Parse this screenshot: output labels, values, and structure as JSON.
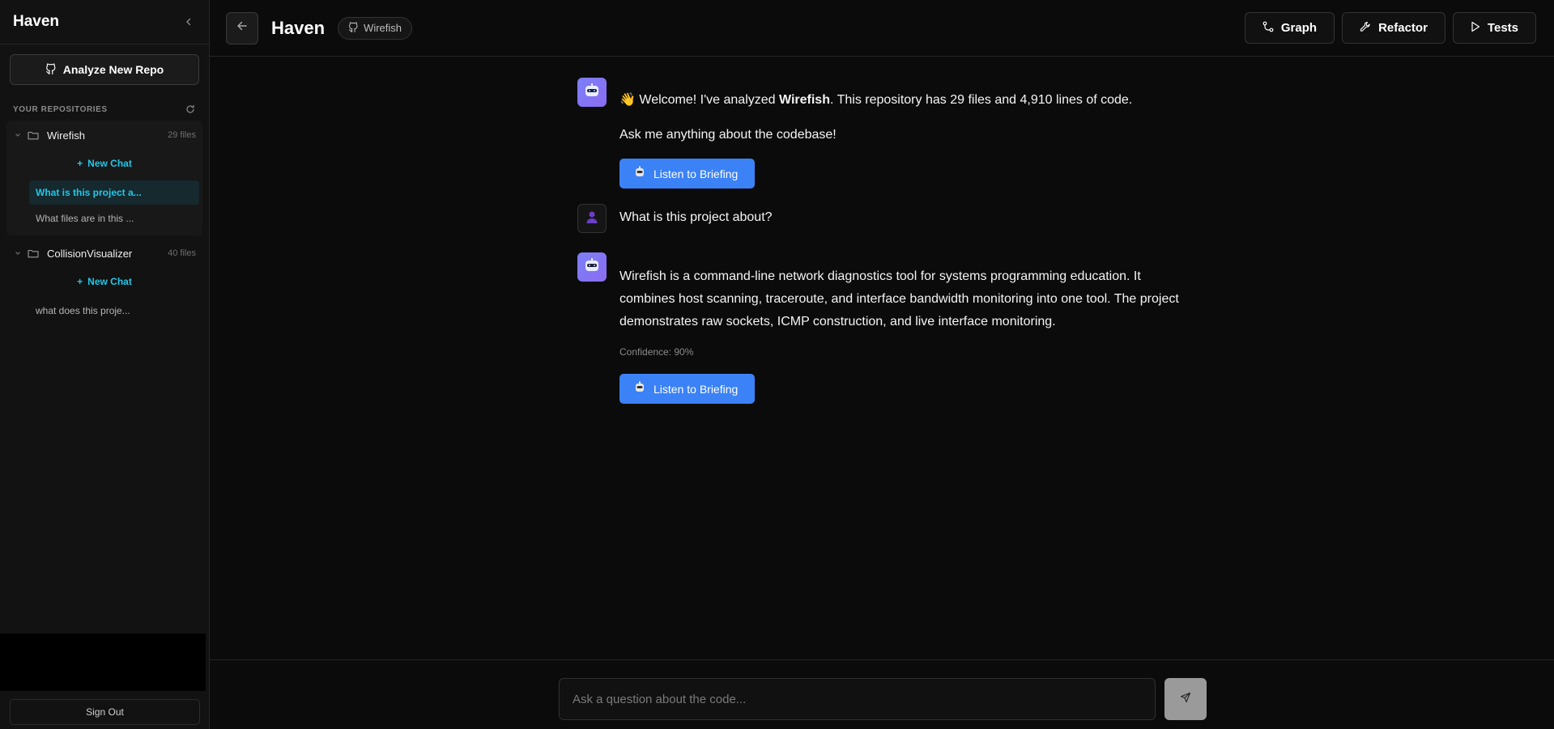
{
  "sidebar": {
    "brand": "Haven",
    "analyze_label": "Analyze New Repo",
    "section_title": "YOUR REPOSITORIES",
    "repos": [
      {
        "name": "Wirefish",
        "count": "29 files",
        "new_chat": "New Chat",
        "chats": [
          "What is this project a...",
          "What files are in this ..."
        ]
      },
      {
        "name": "CollisionVisualizer",
        "count": "40 files",
        "new_chat": "New Chat",
        "chats": [
          "what does this proje..."
        ]
      }
    ],
    "sign_out": "Sign Out"
  },
  "header": {
    "title": "Haven",
    "repo_badge": "Wirefish",
    "actions": {
      "graph": "Graph",
      "refactor": "Refactor",
      "tests": "Tests"
    }
  },
  "messages": {
    "welcome_prefix": "Welcome! I've analyzed ",
    "welcome_repo": "Wirefish",
    "welcome_suffix": ". This repository has 29 files and 4,910 lines of code.",
    "ask": "Ask me anything about the codebase!",
    "listen_label": "Listen to Briefing",
    "user_question": "What is this project about?",
    "answer": "Wirefish is a command-line network diagnostics tool for systems programming education. It combines host scanning, traceroute, and interface bandwidth monitoring into one tool. The project demonstrates raw sockets, ICMP construction, and live interface monitoring.",
    "confidence": "Confidence: 90%"
  },
  "composer": {
    "placeholder": "Ask a question about the code..."
  },
  "colors": {
    "accent": "#22c7e8",
    "primary_button": "#3b82f6",
    "bot_avatar": "#7c7ff7"
  }
}
